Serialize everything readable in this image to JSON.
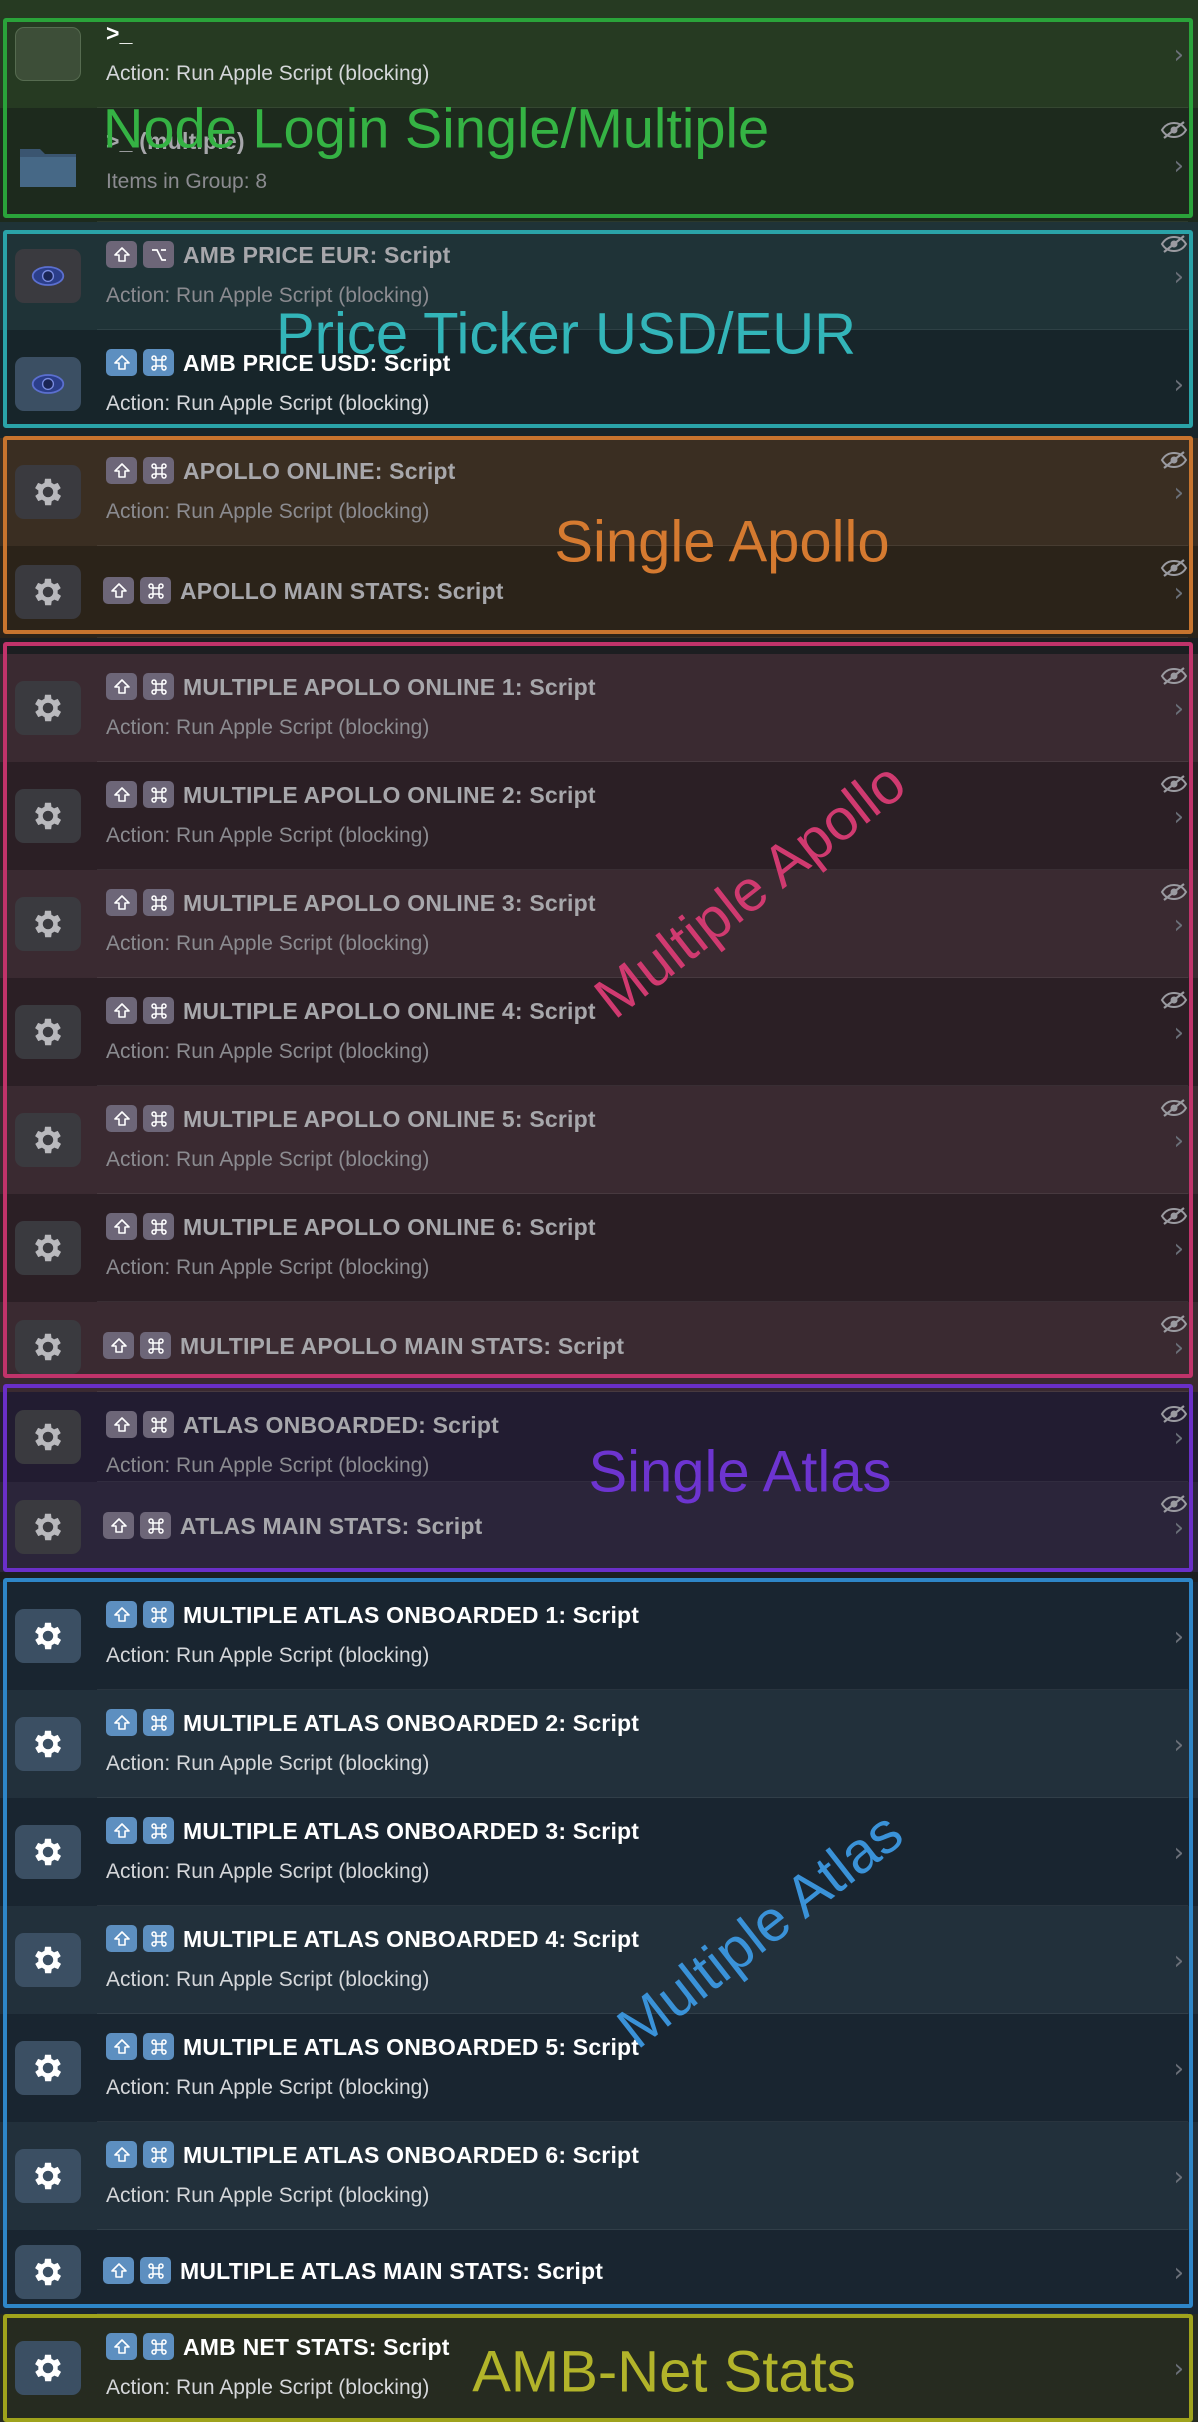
{
  "rows": [
    {
      "title": ">_",
      "subtitle": "Action: Run Apple Script (blocking)",
      "icon": "blank-tile",
      "keys": [],
      "hidden": false,
      "bg": "#263a22",
      "dim": false
    },
    {
      "title": ">_ (multiple)",
      "subtitle": "Items in Group: 8",
      "icon": "folder-icon",
      "keys": [],
      "hidden": true,
      "bg": "#1d2a1d",
      "dim": true
    },
    {
      "title": "AMB PRICE EUR: Script",
      "subtitle": "Action: Run Apple Script (blocking)",
      "icon": "eye-logo-icon",
      "keys": [
        "shift",
        "option"
      ],
      "hidden": true,
      "bg": "#1f3337",
      "dim": true
    },
    {
      "title": "AMB PRICE USD: Script",
      "subtitle": "Action: Run Apple Script (blocking)",
      "icon": "eye-logo-icon",
      "keys": [
        "shift",
        "command"
      ],
      "hidden": false,
      "bg": "#17252a",
      "dim": false
    },
    {
      "title": "APOLLO ONLINE: Script",
      "subtitle": "Action: Run Apple Script (blocking)",
      "icon": "gear-icon",
      "keys": [
        "shift",
        "command"
      ],
      "hidden": true,
      "bg": "#3a2e22",
      "dim": true
    },
    {
      "title": "APOLLO MAIN STATS: Script",
      "subtitle": "",
      "icon": "gear-icon",
      "keys": [
        "shift",
        "command"
      ],
      "hidden": true,
      "bg": "#2b2319",
      "dim": true
    },
    {
      "title": "MULTIPLE APOLLO ONLINE 1: Script",
      "subtitle": "Action: Run Apple Script (blocking)",
      "icon": "gear-icon",
      "keys": [
        "shift",
        "command"
      ],
      "hidden": true,
      "bg": "#3a2a31",
      "dim": true
    },
    {
      "title": "MULTIPLE APOLLO ONLINE 2: Script",
      "subtitle": "Action: Run Apple Script (blocking)",
      "icon": "gear-icon",
      "keys": [
        "shift",
        "command"
      ],
      "hidden": true,
      "bg": "#2b1f25",
      "dim": true
    },
    {
      "title": "MULTIPLE APOLLO ONLINE 3: Script",
      "subtitle": "Action: Run Apple Script (blocking)",
      "icon": "gear-icon",
      "keys": [
        "shift",
        "command"
      ],
      "hidden": true,
      "bg": "#3a2a31",
      "dim": true
    },
    {
      "title": "MULTIPLE APOLLO ONLINE 4: Script",
      "subtitle": "Action: Run Apple Script (blocking)",
      "icon": "gear-icon",
      "keys": [
        "shift",
        "command"
      ],
      "hidden": true,
      "bg": "#2b1f25",
      "dim": true
    },
    {
      "title": "MULTIPLE APOLLO ONLINE 5: Script",
      "subtitle": "Action: Run Apple Script (blocking)",
      "icon": "gear-icon",
      "keys": [
        "shift",
        "command"
      ],
      "hidden": true,
      "bg": "#3a2a31",
      "dim": true
    },
    {
      "title": "MULTIPLE APOLLO ONLINE 6: Script",
      "subtitle": "Action: Run Apple Script (blocking)",
      "icon": "gear-icon",
      "keys": [
        "shift",
        "command"
      ],
      "hidden": true,
      "bg": "#2b1f25",
      "dim": true
    },
    {
      "title": "MULTIPLE APOLLO MAIN STATS: Script",
      "subtitle": "",
      "icon": "gear-icon",
      "keys": [
        "shift",
        "command"
      ],
      "hidden": true,
      "bg": "#3a2a31",
      "dim": true
    },
    {
      "title": "ATLAS ONBOARDED: Script",
      "subtitle": "Action: Run Apple Script (blocking)",
      "icon": "gear-icon",
      "keys": [
        "shift",
        "command"
      ],
      "hidden": true,
      "bg": "#221c31",
      "dim": true
    },
    {
      "title": "ATLAS MAIN STATS: Script",
      "subtitle": "",
      "icon": "gear-icon",
      "keys": [
        "shift",
        "command"
      ],
      "hidden": true,
      "bg": "#2b253a",
      "dim": true
    },
    {
      "title": "MULTIPLE ATLAS ONBOARDED 1: Script",
      "subtitle": "Action: Run Apple Script (blocking)",
      "icon": "gear-icon",
      "keys": [
        "shift",
        "command"
      ],
      "hidden": false,
      "bg": "#192530",
      "dim": false
    },
    {
      "title": "MULTIPLE ATLAS ONBOARDED 2: Script",
      "subtitle": "Action: Run Apple Script (blocking)",
      "icon": "gear-icon",
      "keys": [
        "shift",
        "command"
      ],
      "hidden": false,
      "bg": "#22303b",
      "dim": false
    },
    {
      "title": "MULTIPLE ATLAS ONBOARDED 3: Script",
      "subtitle": "Action: Run Apple Script (blocking)",
      "icon": "gear-icon",
      "keys": [
        "shift",
        "command"
      ],
      "hidden": false,
      "bg": "#192530",
      "dim": false
    },
    {
      "title": "MULTIPLE ATLAS ONBOARDED 4: Script",
      "subtitle": "Action: Run Apple Script (blocking)",
      "icon": "gear-icon",
      "keys": [
        "shift",
        "command"
      ],
      "hidden": false,
      "bg": "#22303b",
      "dim": false
    },
    {
      "title": "MULTIPLE ATLAS ONBOARDED 5: Script",
      "subtitle": "Action: Run Apple Script (blocking)",
      "icon": "gear-icon",
      "keys": [
        "shift",
        "command"
      ],
      "hidden": false,
      "bg": "#192530",
      "dim": false
    },
    {
      "title": "MULTIPLE ATLAS ONBOARDED 6: Script",
      "subtitle": "Action: Run Apple Script (blocking)",
      "icon": "gear-icon",
      "keys": [
        "shift",
        "command"
      ],
      "hidden": false,
      "bg": "#22303b",
      "dim": false
    },
    {
      "title": "MULTIPLE ATLAS MAIN STATS: Script",
      "subtitle": "",
      "icon": "gear-icon",
      "keys": [
        "shift",
        "command"
      ],
      "hidden": false,
      "bg": "#192530",
      "dim": false
    },
    {
      "title": "AMB NET STATS: Script",
      "subtitle": "Action: Run Apple Script (blocking)",
      "icon": "gear-icon",
      "keys": [
        "shift",
        "command"
      ],
      "hidden": false,
      "bg": "#262b20",
      "dim": false
    }
  ],
  "groups": [
    {
      "label": "Node Login Single/Multiple",
      "color": "#2aa33a",
      "label_color": "#35b344"
    },
    {
      "label": "Price Ticker USD/EUR",
      "color": "#2aa3a8",
      "label_color": "#33b5b9"
    },
    {
      "label": "Single Apollo",
      "color": "#c7742e",
      "label_color": "#d57a30"
    },
    {
      "label": "Multiple Apollo",
      "color": "#c0336a",
      "label_color": "#d03a70"
    },
    {
      "label": "Single Atlas",
      "color": "#6a2fc8",
      "label_color": "#6d34d0"
    },
    {
      "label": "Multiple Atlas",
      "color": "#2e86c8",
      "label_color": "#3a92d8"
    },
    {
      "label": "AMB-Net Stats",
      "color": "#9fa31c",
      "label_color": "#b2b42a"
    }
  ],
  "colors": {
    "tile_normal": "#3b4f63",
    "tile_dim": "#3a3a3f",
    "key_normal": "#5d8fc0",
    "key_dim": "#6d6678",
    "text_normal": "#ffffff",
    "text_dim": "#a7a7ab",
    "sub_normal": "#d5d7da",
    "sub_dim": "#8b8b90"
  }
}
